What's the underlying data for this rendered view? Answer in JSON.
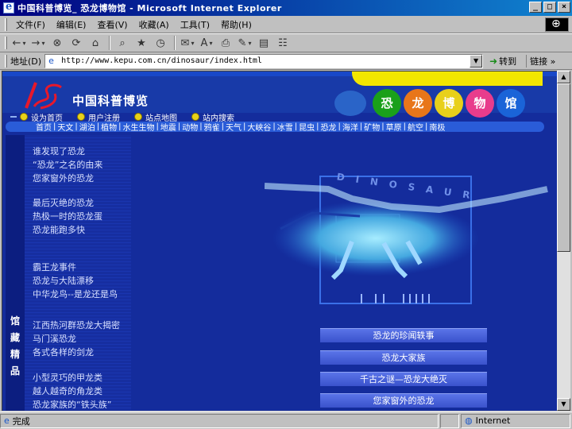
{
  "window": {
    "title": "中国科普博览_ 恐龙博物馆 - Microsoft Internet Explorer",
    "controls": [
      "_",
      "□",
      "×"
    ]
  },
  "menu": [
    "文件(F)",
    "编辑(E)",
    "查看(V)",
    "收藏(A)",
    "工具(T)",
    "帮助(H)"
  ],
  "toolbar_icons": [
    "back-icon",
    "forward-icon",
    "stop-icon",
    "refresh-icon",
    "home-icon",
    "search-icon",
    "favorites-icon",
    "history-icon",
    "mail-icon",
    "print-icon",
    "edit-icon",
    "discuss-icon",
    "messenger-icon"
  ],
  "address": {
    "label": "地址(D)",
    "url": "http://www.kepu.com.cn/dinosaur/index.html",
    "go": "转到",
    "links": "链接 »"
  },
  "site": {
    "name": "中国科普博览",
    "circles": [
      {
        "label": "恐",
        "color": "#1aa01a"
      },
      {
        "label": "龙",
        "color": "#e8761a"
      },
      {
        "label": "博",
        "color": "#e8d01a"
      },
      {
        "label": "物",
        "color": "#e83c8c"
      },
      {
        "label": "馆",
        "color": "#1a64d8"
      }
    ],
    "subnav": [
      "设为首页",
      "用户注册",
      "站点地图",
      "站内搜索"
    ],
    "categories": [
      "首页",
      "天文",
      "湖泊",
      "植物",
      "水生生物",
      "地震",
      "动物",
      "鸦雀",
      "天气",
      "大峡谷",
      "冰雪",
      "昆虫",
      "恐龙",
      "海洋",
      "矿物",
      "草原",
      "航空",
      "南极"
    ],
    "sidebar_label": "馆藏精品",
    "story_groups": [
      [
        "谁发现了恐龙",
        "“恐龙”之名的由来",
        "您家窗外的恐龙"
      ],
      [
        "最后灭绝的恐龙",
        "热极一时的恐龙蛋",
        "恐龙能跑多快"
      ],
      [
        "霸王龙事件",
        "恐龙与大陆漂移",
        "中华龙鸟--是龙还是鸟"
      ],
      [
        "江西热河群恐龙大揭密",
        "马门溪恐龙",
        "各式各样的剑龙"
      ],
      [
        "小型灵巧的甲龙类",
        "越人越奇的角龙类",
        "恐龙家族的“铁头族”"
      ]
    ],
    "hero_word": "DINOSAUR",
    "feature_buttons": [
      "恐龙的珍闻轶事",
      "恐龙大家族",
      "千古之谜—恐龙大绝灭",
      "您家窗外的恐龙"
    ]
  },
  "status": {
    "text": "完成",
    "zone": "Internet"
  }
}
